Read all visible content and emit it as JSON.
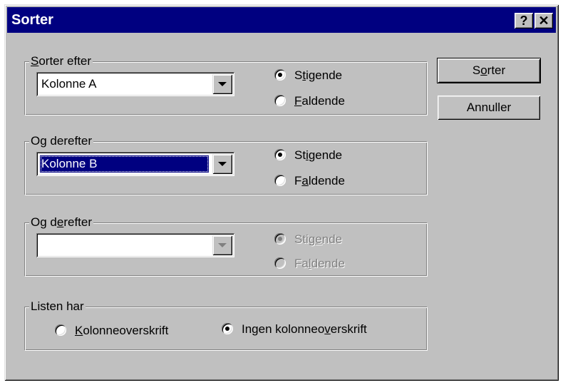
{
  "window": {
    "title": "Sorter",
    "help_label": "?",
    "close_label": "✕"
  },
  "groups": [
    {
      "legend": "Sorter efter",
      "combo_value": "Kolonne A",
      "asc_label": "Stigende",
      "desc_label": "Faldende",
      "selected": "asc"
    },
    {
      "legend": "Og derefter",
      "combo_value": "Kolonne B",
      "asc_label": "Stigende",
      "desc_label": "Faldende",
      "selected": "asc"
    },
    {
      "legend": "Og derefter",
      "combo_value": "",
      "asc_label": "Stigende",
      "desc_label": "Faldende",
      "selected": "asc",
      "disabled": true
    }
  ],
  "header_group": {
    "legend": "Listen har",
    "option_header_label": "Kolonneoverskrift",
    "option_no_header_label": "Ingen kolonneoverskrift",
    "selected": "no_header"
  },
  "buttons": {
    "sort_label": "Sorter",
    "cancel_label": "Annuller"
  }
}
